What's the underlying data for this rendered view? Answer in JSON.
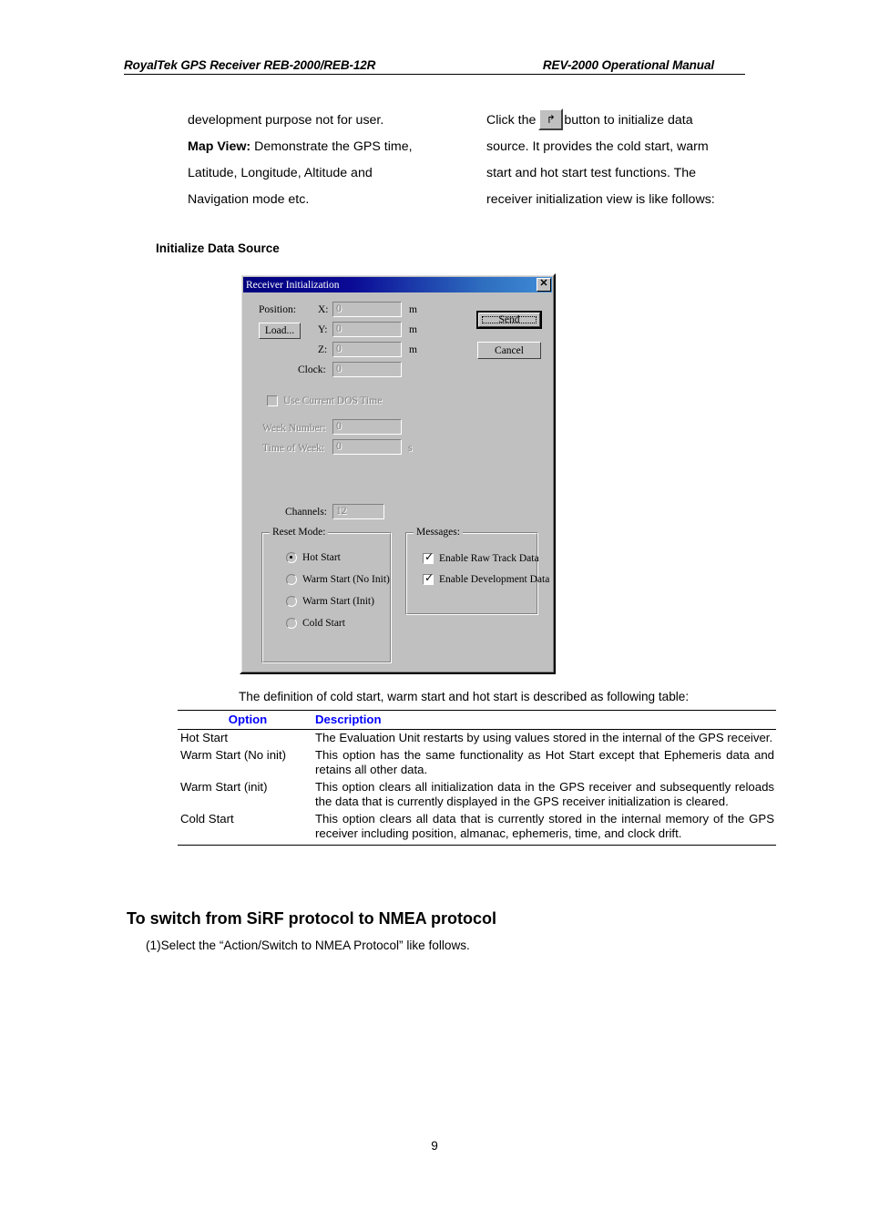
{
  "header": {
    "left": "RoyalTek GPS Receiver REB-2000/REB-12R",
    "right": "REV-2000 Operational Manual"
  },
  "intro": {
    "left_column": [
      "development purpose not for user.",
      "Latitude, Longitude, Altitude and",
      "Navigation mode etc."
    ],
    "map_view_label": "Map View:",
    "map_view_text": " Demonstrate the GPS time,",
    "right_column": {
      "line1_before": "Click the",
      "button_icon": "initialize-data-source-icon",
      "button_glyph": "↱",
      "line1_after": "button to initialize data",
      "line2": "source. It provides the cold start, warm",
      "line3": "start and hot start test functions. The",
      "line4": "receiver initialization view is like follows:"
    }
  },
  "subhead": "Initialize Data Source",
  "dialog": {
    "title": "Receiver Initialization",
    "close_label": "✕",
    "position_label": "Position:",
    "load_button": "Load...",
    "x_label": "X:",
    "y_label": "Y:",
    "z_label": "Z:",
    "x_value": "0",
    "y_value": "0",
    "z_value": "0",
    "unit_m": "m",
    "clock_label": "Clock:",
    "clock_value": "0",
    "use_dos_time_label": "Use Current DOS Time",
    "use_dos_time_checked": false,
    "week_number_label": "Week Number:",
    "week_number_value": "0",
    "time_of_week_label": "Time of Week:",
    "time_of_week_value": "0",
    "unit_s": "s",
    "channels_label": "Channels:",
    "channels_value": "12",
    "send_button": "Send",
    "cancel_button": "Cancel",
    "reset_mode": {
      "title": "Reset Mode:",
      "options": [
        {
          "label": "Hot Start",
          "selected": true
        },
        {
          "label": "Warm Start (No Init)",
          "selected": false
        },
        {
          "label": "Warm Start (Init)",
          "selected": false
        },
        {
          "label": "Cold Start",
          "selected": false
        }
      ]
    },
    "messages": {
      "title": "Messages:",
      "options": [
        {
          "label": "Enable Raw Track Data",
          "checked": true
        },
        {
          "label": "Enable Development Data",
          "checked": true
        }
      ]
    }
  },
  "table": {
    "caption": "The definition of cold start, warm start and hot start is described as following table:",
    "headers": {
      "option": "Option",
      "description": "Description"
    },
    "rows": [
      {
        "option": "Hot Start",
        "description": "The Evaluation Unit restarts by using values stored in the internal of the GPS receiver."
      },
      {
        "option": "Warm Start (No init)",
        "description": "This option has the same functionality as Hot Start except that Ephemeris data and retains all other data."
      },
      {
        "option": "Warm Start (init)",
        "description": "This option clears all initialization data in the GPS receiver and subsequently reloads the data that is currently displayed in the GPS receiver initialization is cleared."
      },
      {
        "option": "Cold Start",
        "description": "This option clears all data that is currently stored in the internal memory of the GPS receiver including position, almanac, ephemeris, time, and clock drift."
      }
    ]
  },
  "section": {
    "title": "To switch from SiRF protocol to NMEA protocol",
    "step1": "(1)Select the “Action/Switch to NMEA Protocol” like follows."
  },
  "page_number": "9"
}
